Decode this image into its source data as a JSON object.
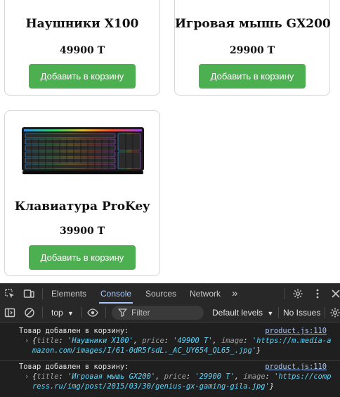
{
  "products": [
    {
      "title": "Наушники X100",
      "price": "49900 Т",
      "button": "Добавить в корзину"
    },
    {
      "title": "Игровая мышь GX200",
      "price": "29900 Т",
      "button": "Добавить в корзину"
    },
    {
      "title": "Клавиатура ProKey",
      "price": "39900 Т",
      "button": "Добавить в корзину"
    }
  ],
  "devtools": {
    "tabs": [
      "Elements",
      "Console",
      "Sources",
      "Network"
    ],
    "active_tab": "Console",
    "more_tabs": "»",
    "context": "top",
    "filter_placeholder": "Filter",
    "levels": "Default levels",
    "issues": "No Issues",
    "logs": [
      {
        "message": "Товар добавлен в корзину:",
        "source": "product.js:110",
        "object": {
          "title": "'Наушники X100'",
          "price": "'49900 Т'",
          "image": "'https://m.media-amazon.com/images/I/61-0dR5fsdL._AC_UY654_QL65_.jpg'"
        }
      },
      {
        "message": "Товар добавлен в корзину:",
        "source": "product.js:110",
        "object": {
          "title": "'Игровая мышь GX200'",
          "price": "'29900 Т'",
          "image": "'https://compress.ru/img/post/2015/03/30/genius-gx-gaming-gila.jpg'"
        }
      }
    ],
    "colors": {
      "background": "#1f1f1f",
      "accent": "#a8c7fa",
      "string": "#5cd5fb"
    }
  },
  "colors": {
    "button": "#4caf50",
    "card_border": "#d6d6d6"
  }
}
